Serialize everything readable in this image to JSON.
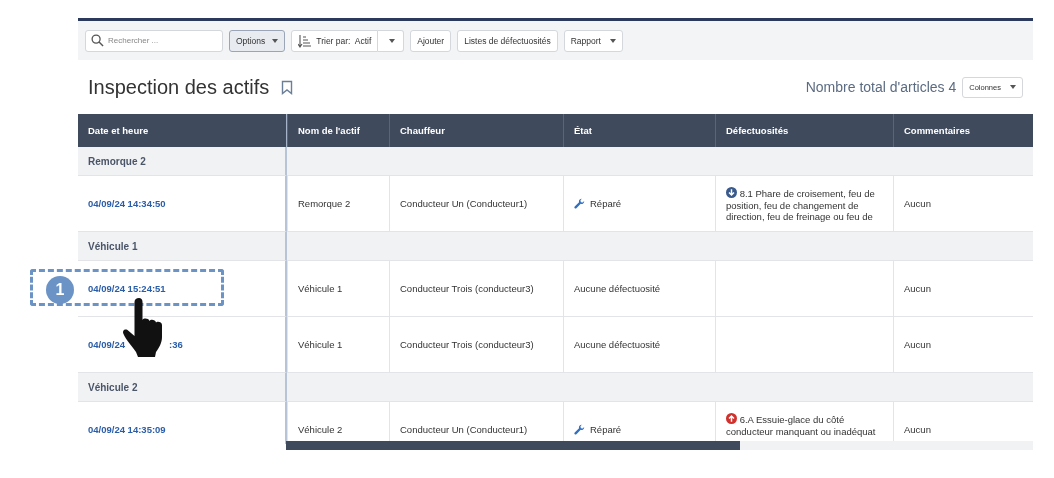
{
  "toolbar": {
    "search": {
      "placeholder": "Rechercher ..."
    },
    "options": {
      "label": "Options",
      "pressed": true
    },
    "sort": {
      "label": "Trier par:",
      "value": "Actif"
    },
    "buttons": [
      {
        "label": "Ajouter",
        "dropdown": false
      },
      {
        "label": "Listes de défectuosités",
        "dropdown": false
      },
      {
        "label": "Rapport",
        "dropdown": true
      }
    ]
  },
  "page": {
    "title": "Inspection des actifs",
    "total": "Nombre total d'articles 4",
    "columns_button": "Colonnes"
  },
  "table": {
    "columns": [
      "Date et heure",
      "Nom de l'actif",
      "Chauffeur",
      "État",
      "Défectuosités",
      "Commentaires"
    ],
    "groups": [
      {
        "name": "Remorque 2",
        "rows": [
          {
            "date": [
              "04/09/24 14:34:50"
            ],
            "asset": "Remorque 2",
            "driver": "Conducteur Un (Conducteur1)",
            "state": "Réparé",
            "repaired": true,
            "defect": {
              "kind": "minor",
              "text": "8.1 Phare de croisement, feu de position, feu de changement de direction, feu de freinage ou feu de"
            },
            "comment": "Aucun"
          }
        ]
      },
      {
        "name": "Véhicule 1",
        "rows": [
          {
            "date": [
              "04/09/24 15:24:51"
            ],
            "asset": "Véhicule 1",
            "driver": "Conducteur Trois (conducteur3)",
            "state": "Aucune défectuosité",
            "repaired": false,
            "comment": "Aucun"
          },
          {
            "date": [
              "04/09/24",
              ":36"
            ],
            "asset": "Véhicule 1",
            "driver": "Conducteur Trois (conducteur3)",
            "state": "Aucune défectuosité",
            "repaired": false,
            "comment": "Aucun"
          }
        ]
      },
      {
        "name": "Véhicule 2",
        "rows": [
          {
            "date": [
              "04/09/24 14:35:09"
            ],
            "asset": "Véhicule 2",
            "driver": "Conducteur Un (Conducteur1)",
            "state": "Réparé",
            "repaired": true,
            "defect": {
              "kind": "major",
              "text": "6.A Essuie-glace du côté conducteur manquant ou inadéquat"
            },
            "comment": "Aucun"
          }
        ]
      }
    ]
  },
  "callout": {
    "number": "1"
  }
}
